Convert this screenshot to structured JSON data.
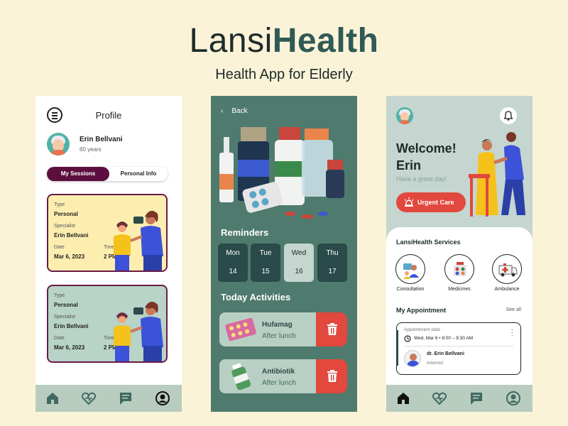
{
  "brand": {
    "name_light": "Lansi",
    "name_bold": "Health",
    "subtitle": "Health App for Elderly"
  },
  "profile_screen": {
    "title": "Profile",
    "user": {
      "name": "Erin Bellvani",
      "age": "60 years"
    },
    "tabs": [
      "My Sessions",
      "Personal Info"
    ],
    "sessions": [
      {
        "type_label": "Type",
        "type": "Personal",
        "specialist_label": "Specialist",
        "specialist": "Erin Bellvani",
        "date_label": "Date",
        "date": "Mar 6, 2023",
        "time_label": "Time",
        "time": "2 PM"
      },
      {
        "type_label": "Type",
        "type": "Personal",
        "specialist_label": "Specialist",
        "specialist": "Erin Bellvani",
        "date_label": "Date",
        "date": "Mar 6, 2023",
        "time_label": "Time",
        "time": "2 PM"
      }
    ]
  },
  "medicine_screen": {
    "back_label": "Back",
    "reminders_title": "Reminders",
    "days": [
      {
        "name": "Mon",
        "date": "14"
      },
      {
        "name": "Tue",
        "date": "15"
      },
      {
        "name": "Wed",
        "date": "16"
      },
      {
        "name": "Thu",
        "date": "17"
      }
    ],
    "activities_title": "Today Activities",
    "activities": [
      {
        "name": "Hufamag",
        "when": "After lunch"
      },
      {
        "name": "Antibiotik",
        "when": "After lunch"
      }
    ]
  },
  "home_screen": {
    "welcome": "Welcome!",
    "name": "Erin",
    "greeting": "Have a great day!",
    "urgent_label": "Urgent Care",
    "services_title": "LansiHealth Services",
    "services": [
      "Consultation",
      "Medicines",
      "Ambulance"
    ],
    "appointment_title": "My Appointment",
    "see_all": "See all",
    "appointment": {
      "date_label": "Appointment date",
      "time": "Wed, Mar 6 • 8:00 – 9:30 AM",
      "doctor": "dr. Erin Bellvani",
      "role": "Internist"
    }
  },
  "colors": {
    "accent": "#2f5a56",
    "maroon": "#5c0f3e",
    "red": "#e2483d",
    "cream": "#fbf3d8"
  }
}
